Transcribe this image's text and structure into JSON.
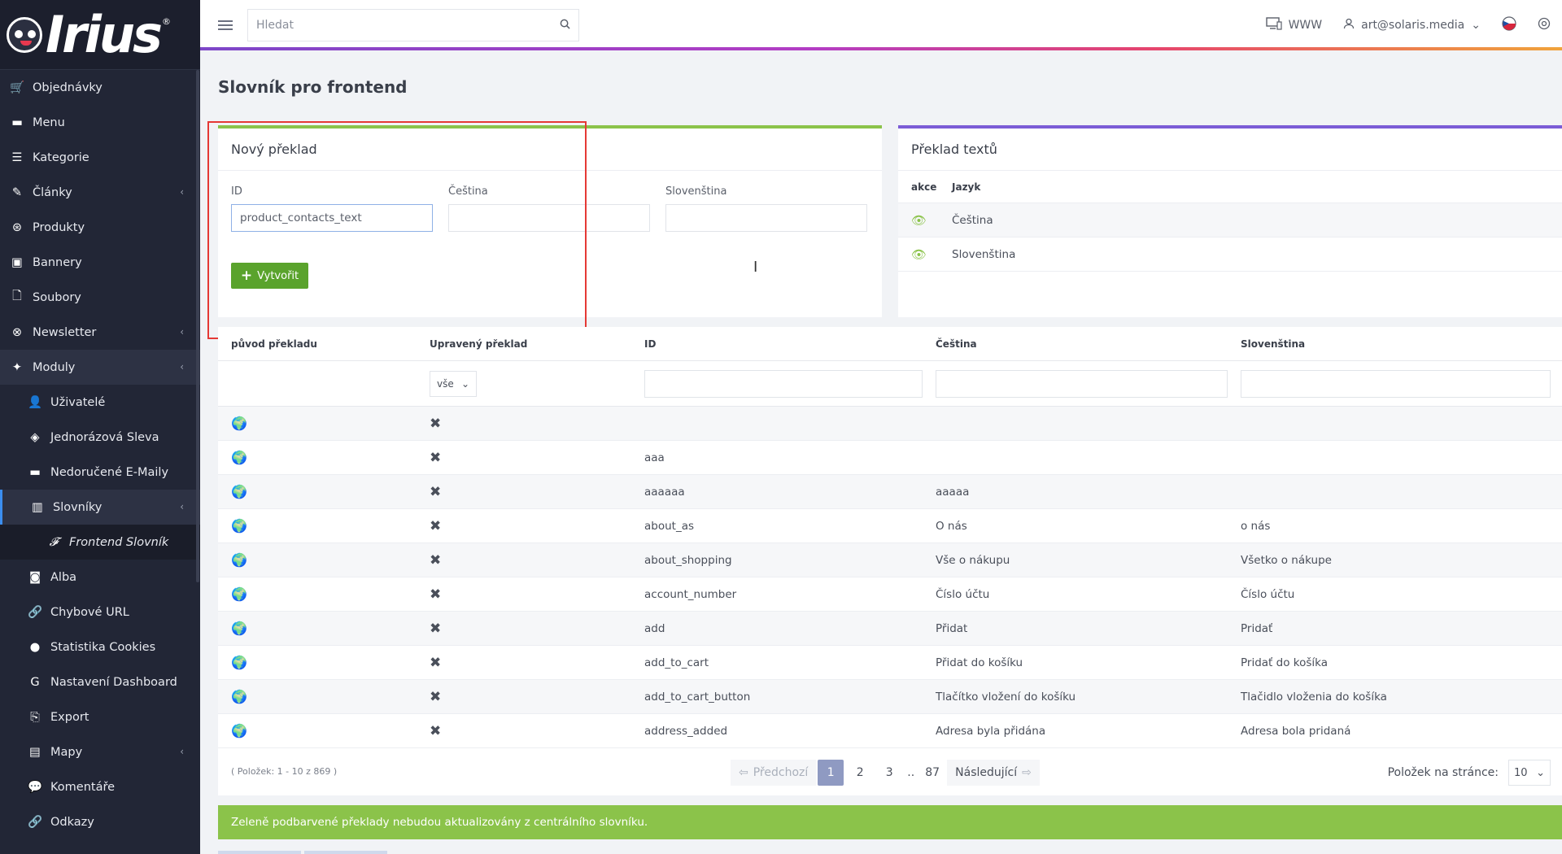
{
  "brand": {
    "logo_text": "Irius",
    "reg_mark": "®"
  },
  "sidebar": {
    "items": [
      {
        "label": "Objednávky",
        "icon": "cart-icon",
        "glyph": "🛒"
      },
      {
        "label": "Menu",
        "icon": "folder-icon",
        "glyph": "▬"
      },
      {
        "label": "Kategorie",
        "icon": "list-icon",
        "glyph": "☰"
      },
      {
        "label": "Články",
        "icon": "pencil-icon",
        "glyph": "✎",
        "chevron": "‹"
      },
      {
        "label": "Produkty",
        "icon": "products-icon",
        "glyph": "⊛"
      },
      {
        "label": "Bannery",
        "icon": "image-icon",
        "glyph": "▣"
      },
      {
        "label": "Soubory",
        "icon": "file-icon",
        "glyph": "🗋"
      },
      {
        "label": "Newsletter",
        "icon": "newsletter-icon",
        "glyph": "⊗",
        "chevron": "‹"
      },
      {
        "label": "Moduly",
        "icon": "puzzle-icon",
        "glyph": "✦",
        "chevron": "‹"
      }
    ],
    "sub_items": [
      {
        "label": "Uživatelé",
        "icon": "user-icon",
        "glyph": "👤"
      },
      {
        "label": "Jednorázová Sleva",
        "icon": "tag-icon",
        "glyph": "◈"
      },
      {
        "label": "Nedoručené E-Maily",
        "icon": "mail-icon",
        "glyph": "▬"
      },
      {
        "label": "Slovníky",
        "icon": "books-icon",
        "glyph": "▥",
        "chevron": "‹"
      }
    ],
    "subsub_item": {
      "label": "Frontend Slovník",
      "icon": "font-icon",
      "glyph": "𝓕"
    },
    "more_items": [
      {
        "label": "Alba",
        "icon": "camera-icon",
        "glyph": "◙"
      },
      {
        "label": "Chybové URL",
        "icon": "link-icon",
        "glyph": "🔗"
      },
      {
        "label": "Statistika Cookies",
        "icon": "cookie-icon",
        "glyph": "●"
      },
      {
        "label": "Nastavení Dashboard",
        "icon": "google-icon",
        "glyph": "G"
      },
      {
        "label": "Export",
        "icon": "export-icon",
        "glyph": "⎘"
      },
      {
        "label": "Mapy",
        "icon": "map-icon",
        "glyph": "▤",
        "chevron": "‹"
      },
      {
        "label": "Komentáře",
        "icon": "comments-icon",
        "glyph": "💬"
      },
      {
        "label": "Odkazy",
        "icon": "link-icon",
        "glyph": "🔗"
      }
    ]
  },
  "topbar": {
    "search_placeholder": "Hledat",
    "www_label": "WWW",
    "user_email": "art@solaris.media"
  },
  "page": {
    "title": "Slovník pro frontend"
  },
  "new_translation": {
    "title": "Nový překlad",
    "id_label": "ID",
    "id_value": "product_contacts_text",
    "cs_label": "Čeština",
    "sk_label": "Slovenština",
    "create_label": "Vytvořit"
  },
  "translate_texts": {
    "title": "Překlad textů",
    "col_action": "akce",
    "col_language": "Jazyk",
    "languages": [
      "Čeština",
      "Slovenština"
    ]
  },
  "table": {
    "headers": {
      "origin": "původ překladu",
      "edited": "Upravený překlad",
      "id": "ID",
      "cs": "Čeština",
      "sk": "Slovenština"
    },
    "edited_filter": "vše",
    "rows": [
      {
        "id": "",
        "cs": "",
        "sk": ""
      },
      {
        "id": "aaa",
        "cs": "",
        "sk": ""
      },
      {
        "id": "aaaaaa",
        "cs": "aaaaa",
        "sk": ""
      },
      {
        "id": "about_as",
        "cs": "O nás",
        "sk": "o nás"
      },
      {
        "id": "about_shopping",
        "cs": "Vše o nákupu",
        "sk": "Všetko o nákupe"
      },
      {
        "id": "account_number",
        "cs": "Číslo účtu",
        "sk": "Číslo účtu"
      },
      {
        "id": "add",
        "cs": "Přidat",
        "sk": "Pridať"
      },
      {
        "id": "add_to_cart",
        "cs": "Přidat do košíku",
        "sk": "Pridať do košíka"
      },
      {
        "id": "add_to_cart_button",
        "cs": "Tlačítko vložení do košíku",
        "sk": "Tlačidlo vloženia do košíka"
      },
      {
        "id": "address_added",
        "cs": "Adresa byla přidána",
        "sk": "Adresa bola pridaná"
      }
    ]
  },
  "pagination": {
    "count_text": "( Položek: 1 - 10 z 869 )",
    "prev_label": "Předchozí",
    "next_label": "Následující",
    "pages": [
      "1",
      "2",
      "3"
    ],
    "ellipsis": "..",
    "last_page": "87",
    "current_page": "1",
    "per_page_label": "Položek na stránce:",
    "per_page_value": "10"
  },
  "notice": "Zeleně podbarvené překlady nebudou aktualizovány z centrálního slovníku.",
  "colors": {
    "sidebar_bg": "#222636",
    "accent_green": "#8bc34a",
    "button_green": "#5aa32c",
    "accent_purple": "#7c5cd6",
    "highlight_red": "#e53935"
  }
}
